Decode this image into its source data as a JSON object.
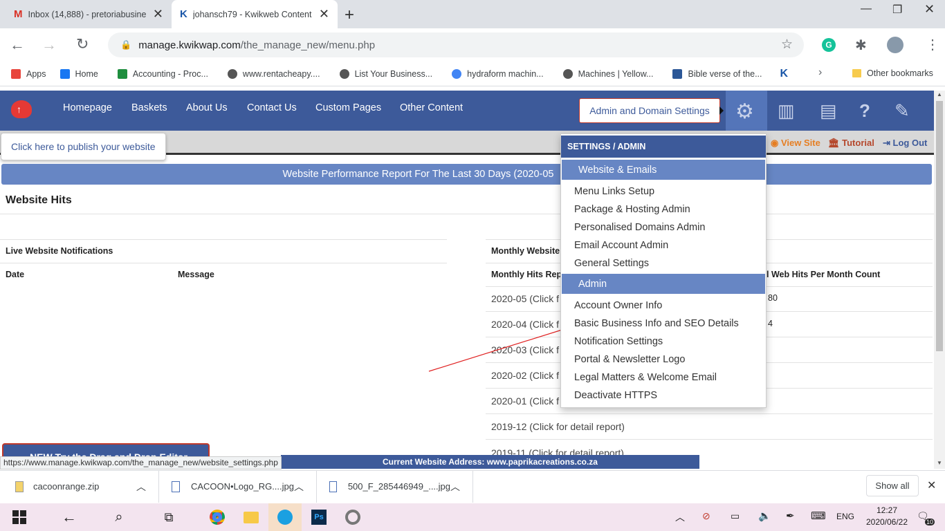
{
  "browser": {
    "tabs": [
      {
        "title": "Inbox (14,888) - pretoriabusine"
      },
      {
        "title": "johansch79 - Kwikweb Content"
      }
    ],
    "url_domain": "manage.kwikwap.com",
    "url_path": "/the_manage_new/menu.php",
    "bookmarks": [
      {
        "label": "Apps",
        "color": "#e8453c"
      },
      {
        "label": "Home",
        "color": "#1877f2"
      },
      {
        "label": "Accounting - Proc...",
        "color": "#1e8e3e"
      },
      {
        "label": "www.rentacheapy....",
        "color": "#555555"
      },
      {
        "label": "List Your Business...",
        "color": "#555555"
      },
      {
        "label": "hydraform machin...",
        "color": "#4285f4"
      },
      {
        "label": "Machines | Yellow...",
        "color": "#555555"
      },
      {
        "label": "Bible verse of the...",
        "color": "#2b5797"
      },
      {
        "label": "",
        "color": "#1a56a8"
      }
    ],
    "other_bookmarks": "Other bookmarks"
  },
  "site": {
    "nav": [
      "Homepage",
      "Baskets",
      "About Us",
      "Contact Us",
      "Custom Pages",
      "Other Content"
    ],
    "admin_button": "Admin and Domain Settings",
    "publish_tip": "Click here to publish your website",
    "links": {
      "view_site": "View Site",
      "tutorial": "Tutorial",
      "logout": "Log Out"
    },
    "perf_title": "Website Performance Report For The Last 30 Days (2020-05",
    "hits_title": "Website Hits",
    "notifications": {
      "title": "Live Website Notifications",
      "col_date": "Date",
      "col_message": "Message"
    },
    "monthly": {
      "title": "Monthly Website",
      "col_report": "Monthly Hits Rep",
      "col_count": "l Web Hits Per Month Count",
      "rows": [
        {
          "label": "2020-05 (Click f",
          "count": "80"
        },
        {
          "label": "2020-04 (Click f",
          "count": "4"
        },
        {
          "label": "2020-03 (Click f",
          "count": ""
        },
        {
          "label": "2020-02 (Click f",
          "count": ""
        },
        {
          "label": "2020-01 (Click f",
          "count": ""
        },
        {
          "label": "2019-12 (Click for detail report)",
          "count": ""
        },
        {
          "label": "2019-11 (Click for detail report)",
          "count": ""
        }
      ]
    },
    "new_button": "NEW Try the Drag and Drop Editor",
    "current_address": "Current Website Address: www.paprikacreations.co.za"
  },
  "dropdown": {
    "header": "SETTINGS / ADMIN",
    "sections": [
      {
        "title": "Website & Emails",
        "items": [
          "Menu Links Setup",
          "Package & Hosting Admin",
          "Personalised Domains Admin",
          "Email Account Admin",
          "General Settings"
        ]
      },
      {
        "title": "Admin",
        "items": [
          "Account Owner Info",
          "Basic Business Info and SEO Details",
          "Notification Settings",
          "Portal & Newsletter Logo",
          "Legal Matters & Welcome Email",
          "Deactivate HTTPS"
        ]
      }
    ]
  },
  "status_url": "https://www.manage.kwikwap.com/the_manage_new/website_settings.php",
  "downloads": {
    "files": [
      "cacoonrange.zip",
      "CACOON•Logo_RG....jpg",
      "500_F_285446949_....jpg"
    ],
    "show_all": "Show all"
  },
  "taskbar": {
    "lang": "ENG",
    "time": "12:27",
    "date": "2020/06/22",
    "notifications": "10"
  }
}
